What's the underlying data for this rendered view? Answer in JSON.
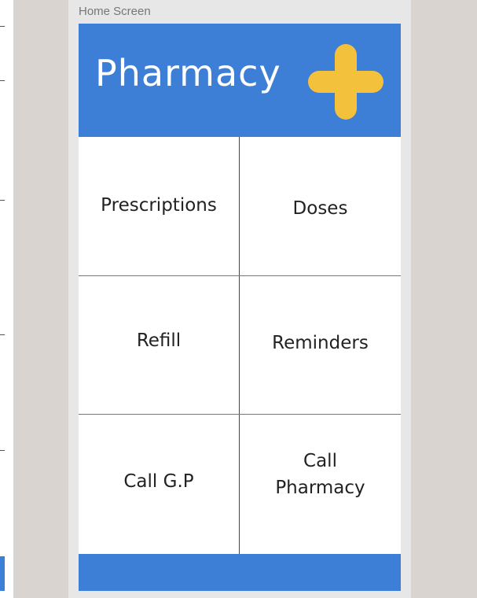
{
  "artboard": {
    "label": "Home Screen"
  },
  "header": {
    "title": "Pharmacy",
    "icon": "plus-icon",
    "background_color": "#3d7fd6",
    "icon_color": "#f4c13d"
  },
  "menu": {
    "items": [
      {
        "label": "Prescriptions"
      },
      {
        "label": "Doses"
      },
      {
        "label": "Refill"
      },
      {
        "label": "Reminders"
      },
      {
        "label": "Call G.P"
      },
      {
        "label": "Call Pharmacy"
      }
    ]
  }
}
